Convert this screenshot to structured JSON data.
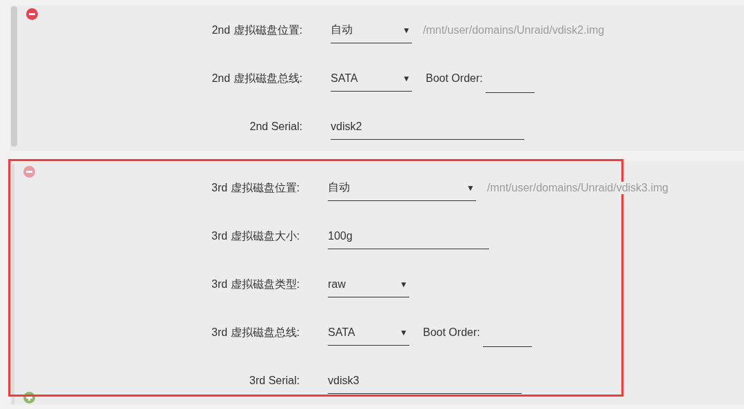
{
  "disks": [
    {
      "remove_dimmed": false,
      "add_button": false,
      "highlighted": false,
      "fields": [
        {
          "label": "2nd 虚拟磁盘位置:",
          "kind": "select",
          "value": "自动",
          "caret": "▼",
          "path": "/mnt/user/domains/Unraid/vdisk2.img"
        },
        {
          "label": "2nd 虚拟磁盘总线:",
          "kind": "select",
          "value": "SATA",
          "caret": "▼",
          "boot_order_label": "Boot Order:"
        },
        {
          "label": "2nd Serial:",
          "kind": "text-long",
          "value": "vdisk2"
        }
      ]
    },
    {
      "remove_dimmed": true,
      "add_button": true,
      "highlighted": true,
      "fields": [
        {
          "label": "3rd 虚拟磁盘位置:",
          "kind": "select-long",
          "value": "自动",
          "caret": "▼",
          "path": "/mnt/user/domains/Unraid/vdisk3.img"
        },
        {
          "label": "3rd 虚拟磁盘大小:",
          "kind": "text",
          "value": "100g"
        },
        {
          "label": "3rd 虚拟磁盘类型:",
          "kind": "select",
          "value": "raw",
          "caret": "▼"
        },
        {
          "label": "3rd 虚拟磁盘总线:",
          "kind": "select",
          "value": "SATA",
          "caret": "▼",
          "boot_order_label": "Boot Order:"
        },
        {
          "label": "3rd Serial:",
          "kind": "text-long",
          "value": "vdisk3"
        }
      ]
    }
  ]
}
